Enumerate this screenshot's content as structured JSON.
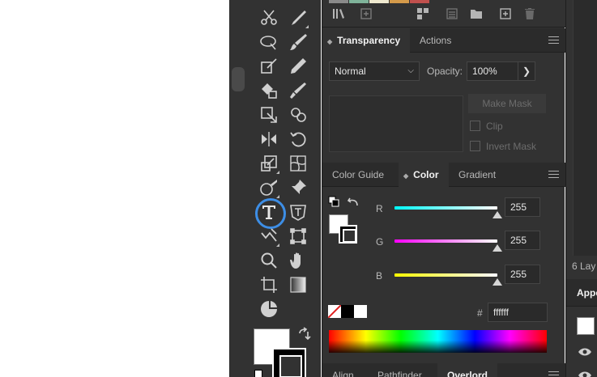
{
  "transparency_panel": {
    "tabs": [
      {
        "label": "Transparency",
        "active": true
      },
      {
        "label": "Actions",
        "active": false
      }
    ],
    "blend_mode": "Normal",
    "opacity_label": "Opacity:",
    "opacity_value": "100%",
    "make_mask_label": "Make Mask",
    "clip_label": "Clip",
    "invert_mask_label": "Invert Mask"
  },
  "color_panel": {
    "tabs": [
      {
        "label": "Color Guide",
        "active": false
      },
      {
        "label": "Color",
        "active": true
      },
      {
        "label": "Gradient",
        "active": false
      }
    ],
    "channels": [
      {
        "label": "R",
        "value": "255",
        "gradient": [
          "#00ffff",
          "#ffffff"
        ]
      },
      {
        "label": "G",
        "value": "255",
        "gradient": [
          "#ff00ff",
          "#ffffff"
        ]
      },
      {
        "label": "B",
        "value": "255",
        "gradient": [
          "#ffff00",
          "#ffffff"
        ]
      }
    ],
    "hex_symbol": "#",
    "hex_value": "ffffff"
  },
  "bottom_panel": {
    "tabs": [
      {
        "label": "Align",
        "active": false
      },
      {
        "label": "Pathfinder",
        "active": false
      },
      {
        "label": "Overlord",
        "active": true
      }
    ]
  },
  "right_column": {
    "layers_count": "6 Lay",
    "appearance_label": "Appe"
  },
  "library_swatches": [
    "#8a8a8a",
    "#7fb39a",
    "#f0ead0",
    "#d49a4a",
    "#c0504d"
  ],
  "accent_color": "#3d8ee6",
  "tools": [
    "scissors-icon",
    "knife-icon",
    "width-icon",
    "paintbrush-icon",
    "shaper-icon",
    "pencil-icon",
    "live-paint-icon",
    "blob-brush-icon",
    "perspective-grid-icon",
    "shape-builder-icon",
    "reflect-icon",
    "rotate-icon",
    "scale-icon",
    "mesh-icon",
    "eraser-icon",
    "pin-icon",
    "type-icon",
    "touch-type-icon",
    "warp-icon",
    "free-transform-icon",
    "zoom-icon",
    "hand-icon",
    "artboard-icon",
    "gradient-icon",
    "chart-icon"
  ]
}
